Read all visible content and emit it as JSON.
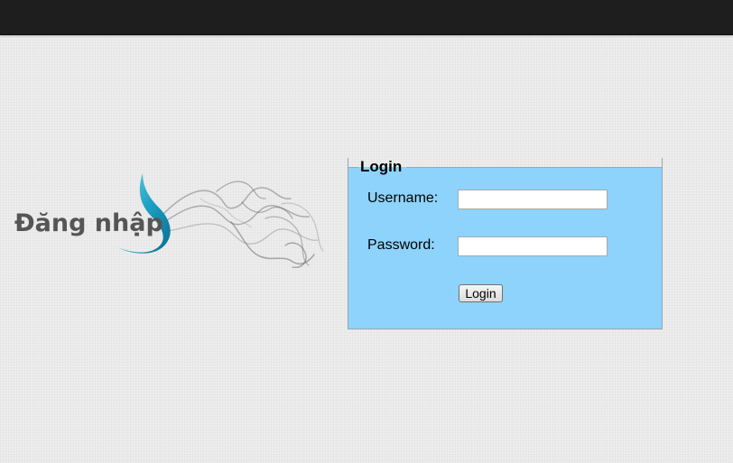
{
  "header": {
    "background_color": "#1e1e1e"
  },
  "logo": {
    "text": "Đăng nhập",
    "text_color": "#555555",
    "swoosh_icon": "blue-swoosh-icon",
    "smoke_image": "smoke-image"
  },
  "login": {
    "legend": "Login",
    "background_color": "#8dd3fb",
    "username_label": "Username:",
    "username_value": "",
    "password_label": "Password:",
    "password_value": "",
    "button_label": "Login"
  }
}
